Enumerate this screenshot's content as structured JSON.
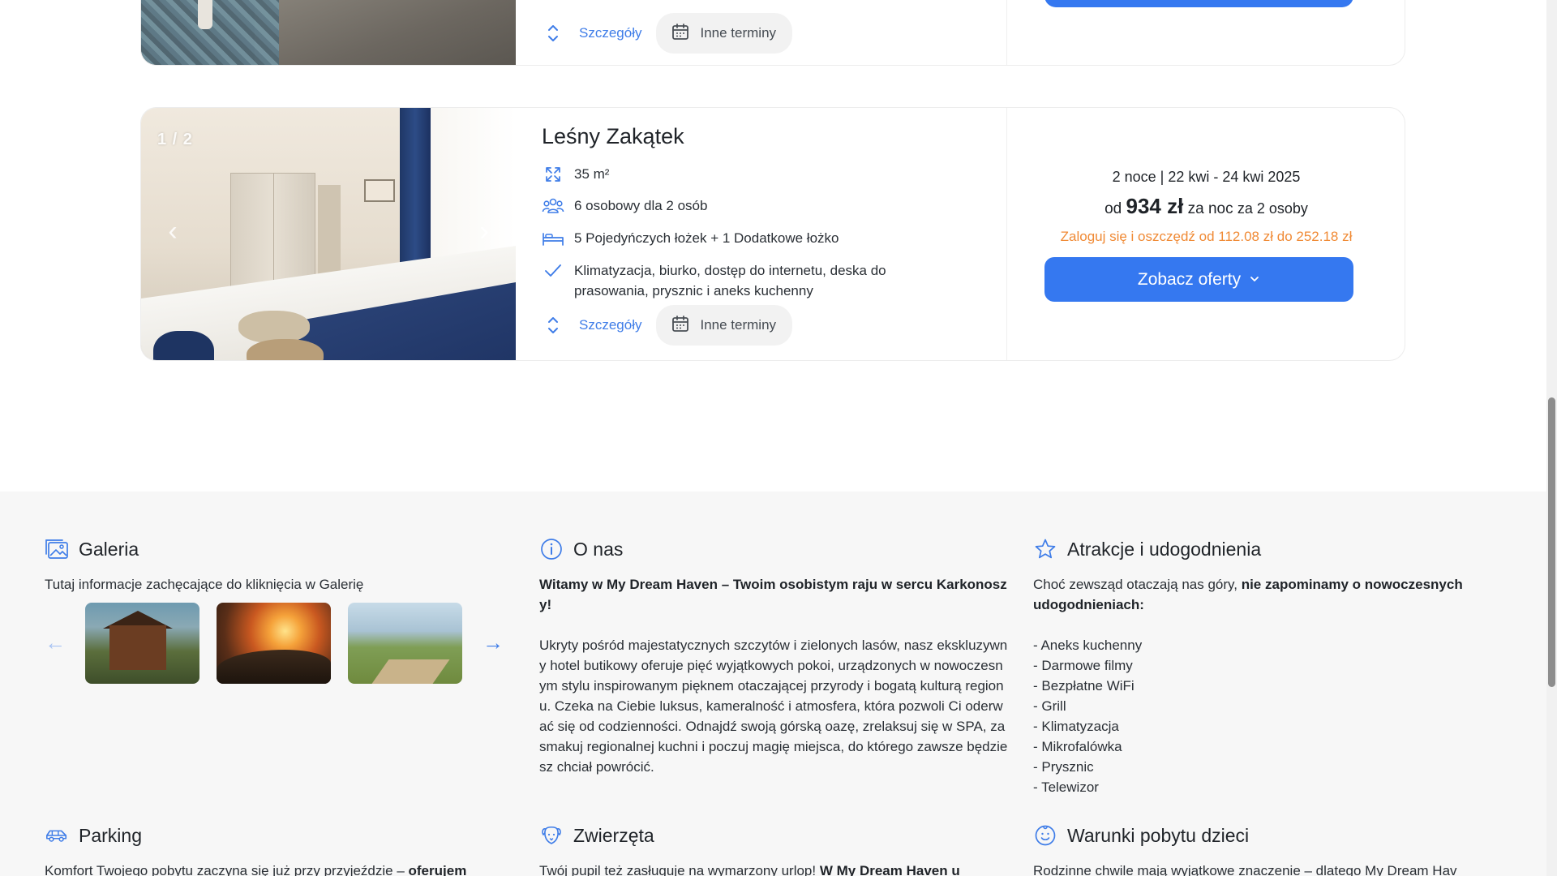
{
  "top_card": {
    "details_label": "Szczegóły",
    "other_dates_label": "Inne terminy"
  },
  "room": {
    "photo_counter": "1 / 2",
    "title": "Leśny Zakątek",
    "area": "35 m²",
    "capacity": "6 osobowy dla 2 osób",
    "beds": "5 Pojedyńczych łożek + 1 Dodatkowe łożko",
    "amenities": "Klimatyzacja, biurko, dostęp do internetu, deska do prasowania, prysznic i aneks kuchenny",
    "details_label": "Szczegóły",
    "other_dates_label": "Inne terminy",
    "price": {
      "nights_dates": "2 noce | 22 kwi - 24 kwi 2025",
      "prefix": "od",
      "amount": "934 zł",
      "per_night": "za noc",
      "per_persons": "za 2 osoby",
      "promo": "Zaloguj się i oszczędź od 112.08 zł do 252.18 zł"
    },
    "offers_button": "Zobacz oferty"
  },
  "gallery": {
    "title": "Galeria",
    "subtitle": "Tutaj informacje zachęcające do kliknięcia w Galerię"
  },
  "about": {
    "title": "O nas",
    "lead": "Witamy w My Dream Haven – Twoim osobistym raju w sercu Karkonoszy!",
    "body": "Ukryty pośród majestatycznych szczytów i zielonych lasów, nasz ekskluzywny hotel butikowy oferuje pięć wyjątkowych pokoi, urządzonych w nowoczesnym stylu inspirowanym pięknem otaczającej przyrody i bogatą kulturą regionu. Czeka na Ciebie luksus, kameralność i atmosfera, która pozwoli Ci oderwać się od codzienności. Odnajdź swoją górską oazę, zrelaksuj się w SPA, zasmakuj regionalnej kuchni i poczuj magię miejsca, do którego zawsze będziesz chciał powrócić."
  },
  "amenities": {
    "title": "Atrakcje i udogodnienia",
    "intro_normal": "Choć zewsząd otaczają nas góry, ",
    "intro_bold": "nie zapominamy o nowoczesnych udogodnieniach:",
    "items": [
      "- Aneks kuchenny",
      "- Darmowe filmy",
      "- Bezpłatne WiFi",
      "- Grill",
      "- Klimatyzacja",
      "- Mikrofalówka",
      "- Prysznic",
      "- Telewizor"
    ]
  },
  "parking": {
    "title": "Parking",
    "text_normal": "Komfort Twojego pobytu zaczyna się już przy przyjeździe – ",
    "text_bold": "oferujem"
  },
  "pets": {
    "title": "Zwierzęta",
    "text_normal": "Twój pupil też zasługuje na wymarzony urlop! ",
    "text_bold": "W My Dream Haven u"
  },
  "kids": {
    "title": "Warunki pobytu dzieci",
    "text_normal": "Rodzinne chwile mają wyjątkowe znaczenie – dlatego My Dream Hav"
  },
  "colors": {
    "accent": "#3578f0",
    "link": "#3f7de8",
    "promo": "#f08a35",
    "section_bg": "#f7f7f7"
  }
}
